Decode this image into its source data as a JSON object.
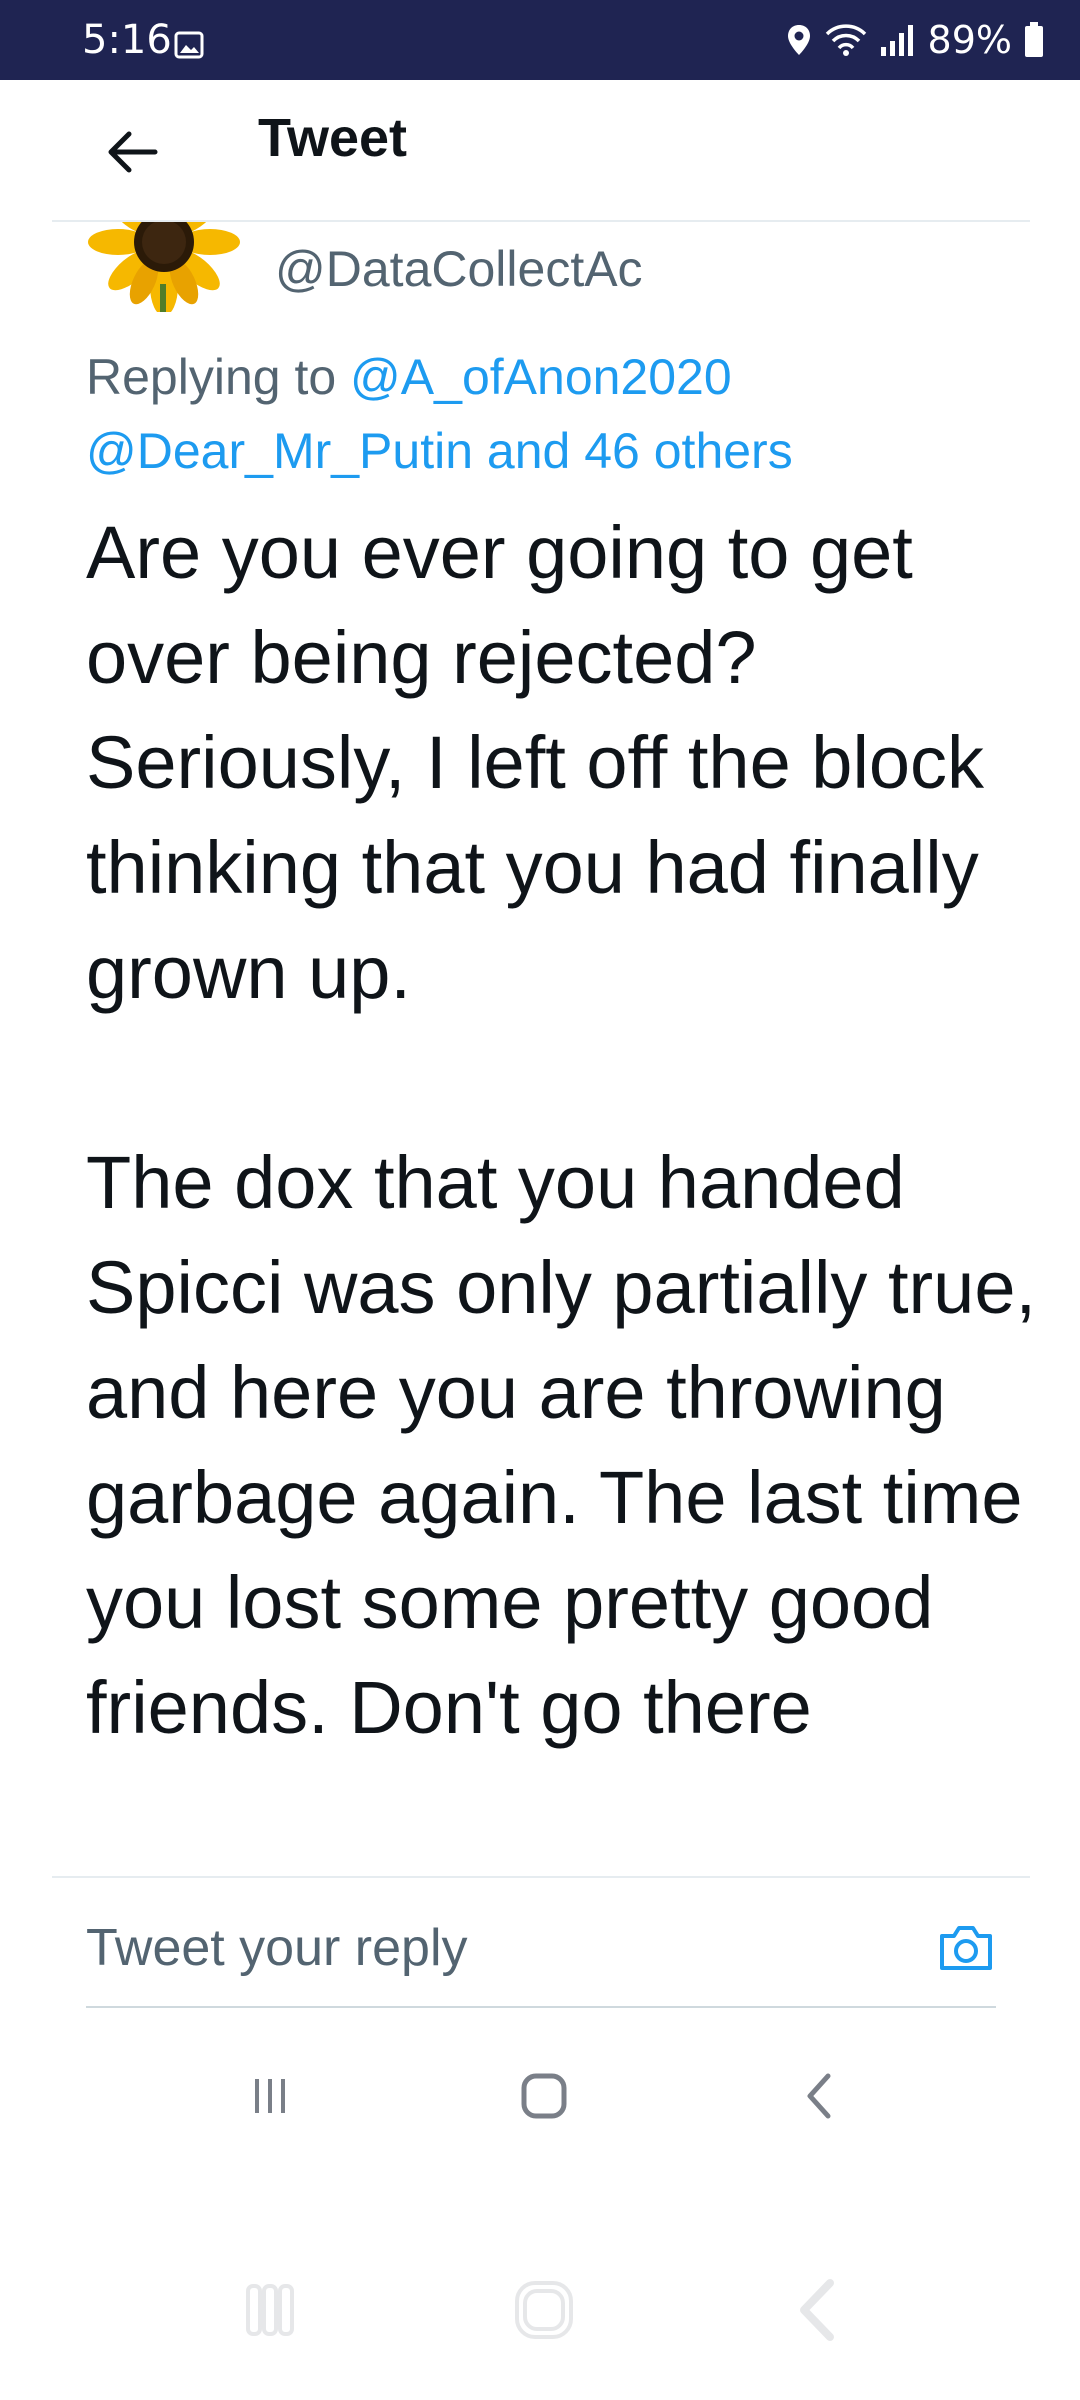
{
  "status_bar": {
    "time": "5:16",
    "battery": "89%",
    "icons": [
      "gallery-icon",
      "location-icon",
      "wifi-icon",
      "signal-icon",
      "battery-icon"
    ],
    "background": "#1f2452"
  },
  "header": {
    "back_icon": "arrow-left-icon",
    "title": "Tweet"
  },
  "tweet": {
    "avatar": "sunflower",
    "handle": "@DataCollectAc",
    "replying_prefix": "Replying to ",
    "replying_user": "@A_ofAnon2020",
    "replying_user2": "@Dear_Mr_Putin",
    "replying_and": " and ",
    "replying_others": "46 others",
    "body": "Are you ever going to get over being rejected? Seriously, I left off the block thinking that you had finally grown up.\n\nThe dox that you handed Spicci was only partially true, and here you are throwing garbage again. The last time you lost some pretty good friends. Don't go there"
  },
  "reply": {
    "placeholder": "Tweet your reply",
    "camera_icon": "camera-icon"
  },
  "nav": {
    "icons": [
      "recents-icon",
      "home-icon",
      "back-icon"
    ]
  },
  "colors": {
    "link": "#1d9bf0",
    "secondary_text": "#536471",
    "primary_text": "#0f1419"
  }
}
